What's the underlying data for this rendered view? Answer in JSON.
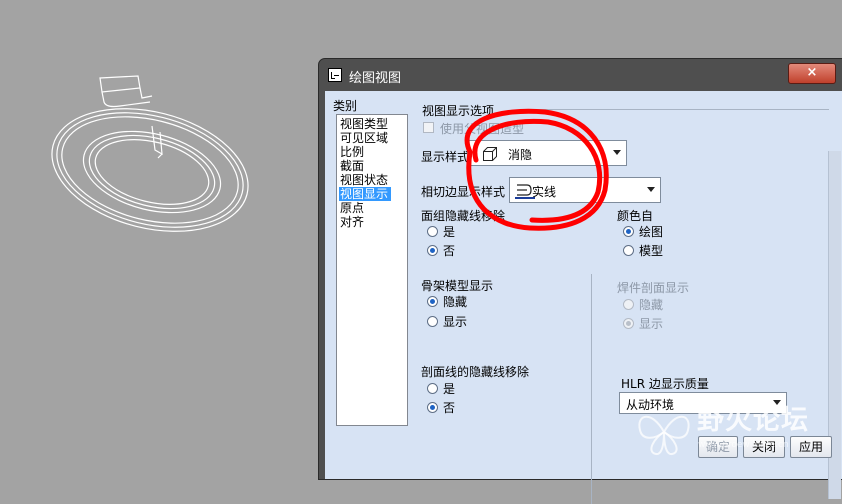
{
  "dialog": {
    "title": "绘图视图",
    "close": "×"
  },
  "category": {
    "label": "类别",
    "items": [
      "视图类型",
      "可见区域",
      "比例",
      "截面",
      "视图状态",
      "视图显示",
      "原点",
      "对齐"
    ],
    "selected": "视图显示"
  },
  "view_display": {
    "section_title": "视图显示选项",
    "use_parent_label": "使用父视图造型",
    "display_style_label": "显示样式",
    "display_style_value": "消隐",
    "tangent_edge_label": "相切边显示样式",
    "tangent_edge_value": "实线",
    "face_hidden_removal": {
      "label": "面组隐藏线移除",
      "options": [
        "是",
        "否"
      ],
      "selected": "否"
    },
    "color_from": {
      "label": "颜色自",
      "options": [
        "绘图",
        "模型"
      ],
      "selected": "绘图"
    },
    "skeleton_display": {
      "label": "骨架模型显示",
      "options": [
        "隐藏",
        "显示"
      ],
      "selected": "隐藏"
    },
    "weld_xsec_display": {
      "label": "焊件剖面显示",
      "options": [
        "隐藏",
        "显示"
      ],
      "selected": "显示",
      "disabled": true
    },
    "xsec_hidden_removal": {
      "label": "剖面线的隐藏线移除",
      "options": [
        "是",
        "否"
      ],
      "selected": "否"
    },
    "hlr_quality": {
      "label": "HLR 边显示质量",
      "value": "从动环境"
    }
  },
  "buttons": {
    "ok": "确定",
    "close": "关闭",
    "apply": "应用"
  },
  "watermark": {
    "text": "野火论坛",
    "url": "www.proewildfire.cn"
  },
  "colors": {
    "annotation": "#ff0000",
    "background": "#a3a3a3",
    "dialog_client": "#d7e3f4",
    "selection": "#3399ff"
  }
}
